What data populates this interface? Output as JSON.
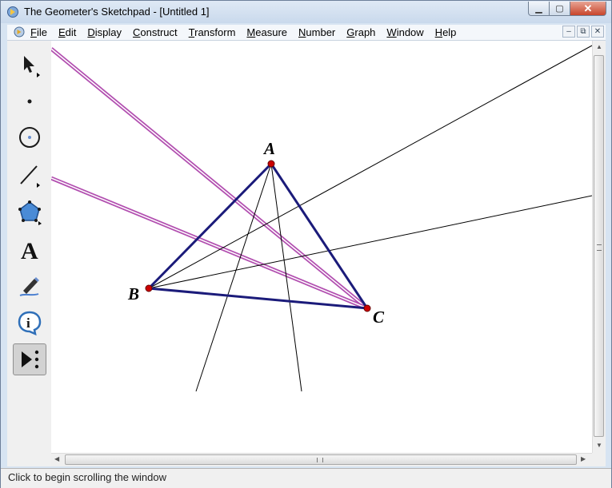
{
  "window": {
    "title": "The Geometer's Sketchpad - [Untitled 1]"
  },
  "title_buttons": {
    "minimize": "▁",
    "maximize": "▢",
    "close": "✕"
  },
  "menu": [
    {
      "label": "File",
      "key": "F"
    },
    {
      "label": "Edit",
      "key": "E"
    },
    {
      "label": "Display",
      "key": "D"
    },
    {
      "label": "Construct",
      "key": "C"
    },
    {
      "label": "Transform",
      "key": "T"
    },
    {
      "label": "Measure",
      "key": "M"
    },
    {
      "label": "Number",
      "key": "N"
    },
    {
      "label": "Graph",
      "key": "G"
    },
    {
      "label": "Window",
      "key": "W"
    },
    {
      "label": "Help",
      "key": "H"
    }
  ],
  "doc_buttons": {
    "minimize": "–",
    "restore": "⧉",
    "close": "✕"
  },
  "tools": [
    {
      "name": "arrow-tool-icon",
      "icon": "arrow-cursor"
    },
    {
      "name": "point-tool-icon",
      "icon": "point"
    },
    {
      "name": "compass-tool-icon",
      "icon": "circle"
    },
    {
      "name": "straightedge-tool-icon",
      "icon": "segment"
    },
    {
      "name": "polygon-tool-icon",
      "icon": "pentagon"
    },
    {
      "name": "text-tool-icon",
      "icon": "A"
    },
    {
      "name": "marker-tool-icon",
      "icon": "pen"
    },
    {
      "name": "information-tool-icon",
      "icon": "i"
    },
    {
      "name": "custom-tool-icon",
      "icon": "play-dots"
    }
  ],
  "sketch": {
    "points": [
      {
        "label": "A"
      },
      {
        "label": "B"
      },
      {
        "label": "C"
      }
    ],
    "colors": {
      "triangle": "#1b1b7a",
      "point": "#cc0000",
      "highlight": "#b24fb0",
      "line": "#000000"
    }
  },
  "status": {
    "text": "Click to begin scrolling the window"
  }
}
